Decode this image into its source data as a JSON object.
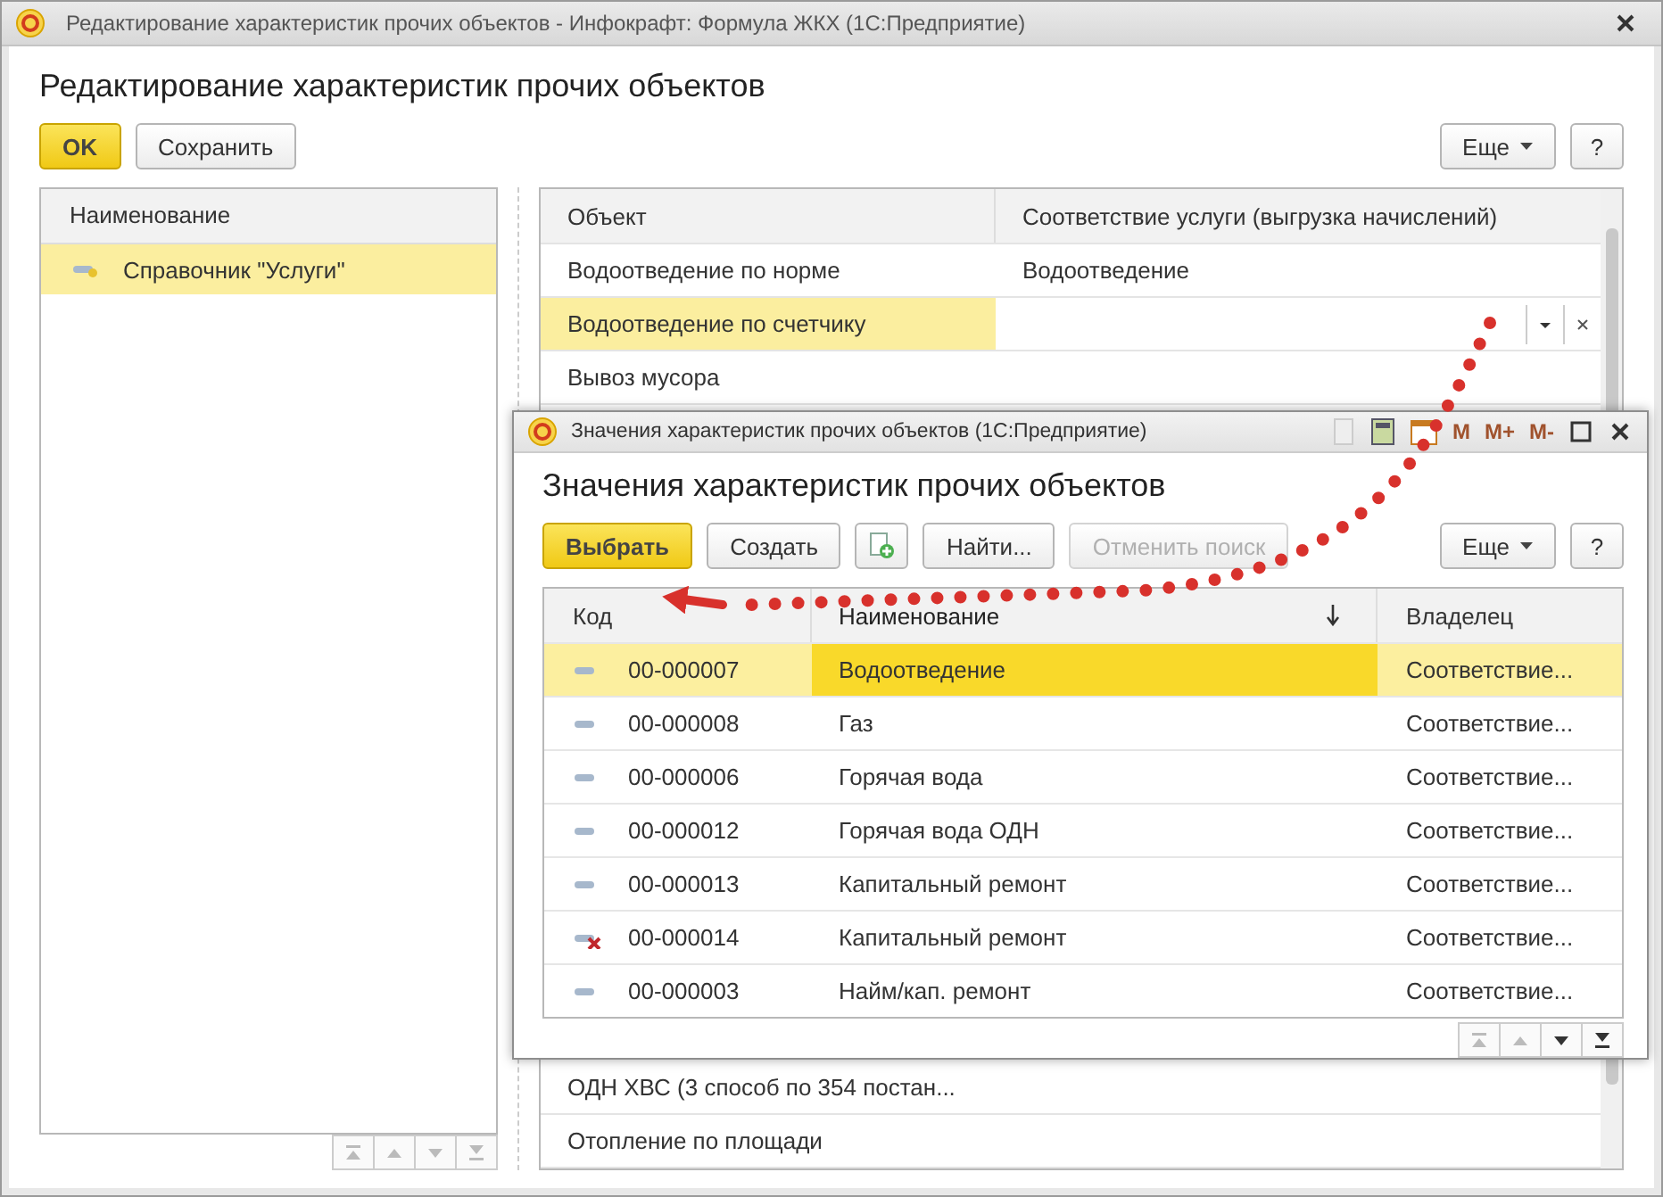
{
  "window": {
    "title": "Редактирование характеристик прочих объектов - Инфокрафт: Формула ЖКХ  (1С:Предприятие)"
  },
  "heading": "Редактирование характеристик прочих объектов",
  "toolbar": {
    "buttons": [
      {
        "label": "OK",
        "kind": "default"
      },
      {
        "label": "Сохранить",
        "kind": "plain"
      }
    ],
    "more": "Еще",
    "help": "?"
  },
  "left_list": {
    "column": "Наименование",
    "items": [
      {
        "label": "Справочник \"Услуги\"",
        "selected": true
      }
    ],
    "nav": [
      {
        "kind": "first",
        "disabled": true
      },
      {
        "kind": "up",
        "disabled": true
      },
      {
        "kind": "down",
        "disabled": true
      },
      {
        "kind": "last",
        "disabled": true
      }
    ]
  },
  "right_table": {
    "columns": [
      "Объект",
      "Соответствие услуги (выгрузка начислений)"
    ],
    "rows": [
      {
        "object": "Водоотведение по норме",
        "service": "Водоотведение",
        "selected": false
      },
      {
        "object": "Водоотведение по счетчику",
        "selected": true
      },
      {
        "object": "Вывоз мусора",
        "selected": false
      }
    ],
    "bottom_rows": [
      {
        "object": "ОДН ХВС (3 способ по 354 постан..."
      },
      {
        "object": "Отопление по площади"
      }
    ]
  },
  "popup": {
    "title": "Значения характеристик прочих объектов  (1С:Предприятие)",
    "memory_buttons": [
      "M",
      "M+",
      "M-"
    ],
    "heading": "Значения характеристик прочих объектов",
    "buttons": [
      {
        "kind": "default",
        "label": "Выбрать",
        "disabled": false
      },
      {
        "kind": "plain",
        "label": "Создать",
        "disabled": false
      },
      {
        "kind": "copy"
      },
      {
        "kind": "plain",
        "label": "Найти...",
        "disabled": false
      },
      {
        "kind": "plain",
        "label": "Отменить поиск",
        "disabled": true
      }
    ],
    "more": "Еще",
    "help": "?",
    "columns": [
      {
        "label": "Код",
        "sorted": false
      },
      {
        "label": "Наименование",
        "sorted": true
      },
      {
        "label": "Владелец",
        "sorted": false
      }
    ],
    "rows": [
      {
        "code": "00-000007",
        "name": "Водоотведение",
        "owner": "Соответствие...",
        "selected": true,
        "deleted": false
      },
      {
        "code": "00-000008",
        "name": "Газ",
        "owner": "Соответствие...",
        "selected": false,
        "deleted": false
      },
      {
        "code": "00-000006",
        "name": "Горячая вода",
        "owner": "Соответствие...",
        "selected": false,
        "deleted": false
      },
      {
        "code": "00-000012",
        "name": "Горячая вода ОДН",
        "owner": "Соответствие...",
        "selected": false,
        "deleted": false
      },
      {
        "code": "00-000013",
        "name": "Капитальный ремонт",
        "owner": "Соответствие...",
        "selected": false,
        "deleted": false
      },
      {
        "code": "00-000014",
        "name": "Капитальный ремонт",
        "owner": "Соответствие...",
        "selected": false,
        "deleted": true
      },
      {
        "code": "00-000003",
        "name": "Найм/кап. ремонт",
        "owner": "Соответствие...",
        "selected": false,
        "deleted": false
      }
    ],
    "nav": [
      {
        "kind": "first",
        "disabled": true
      },
      {
        "kind": "up",
        "disabled": true
      },
      {
        "kind": "down",
        "disabled": false
      },
      {
        "kind": "last",
        "disabled": false
      }
    ]
  }
}
